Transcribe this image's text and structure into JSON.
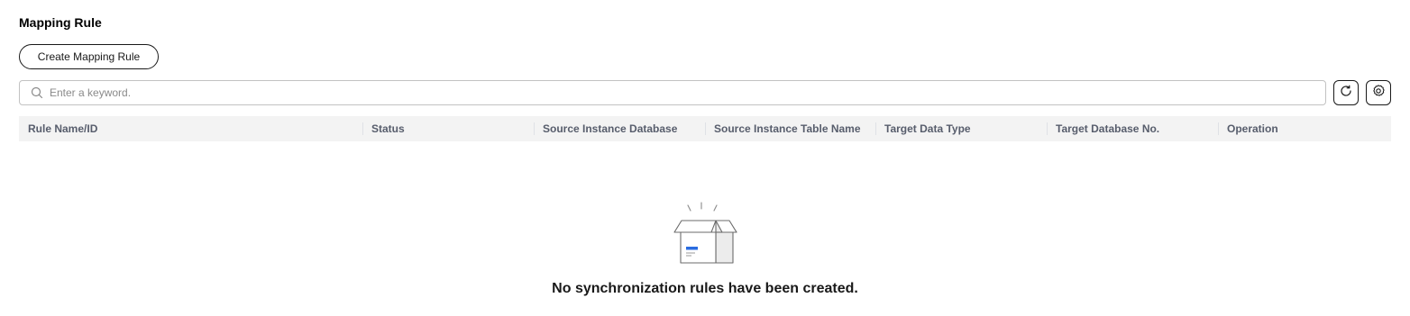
{
  "section": {
    "title": "Mapping Rule"
  },
  "toolbar": {
    "create_label": "Create Mapping Rule"
  },
  "search": {
    "placeholder": "Enter a keyword.",
    "value": ""
  },
  "table": {
    "columns": [
      "Rule Name/ID",
      "Status",
      "Source Instance Database",
      "Source Instance Table Name",
      "Target Data Type",
      "Target Database No.",
      "Operation"
    ],
    "rows": []
  },
  "empty": {
    "message": "No synchronization rules have been created."
  },
  "icons": {
    "search": "search-icon",
    "refresh": "refresh-icon",
    "settings": "gear-icon",
    "empty": "empty-box-icon"
  },
  "colors": {
    "accent": "#2a6ce0",
    "header_bg": "#f3f3f3"
  }
}
